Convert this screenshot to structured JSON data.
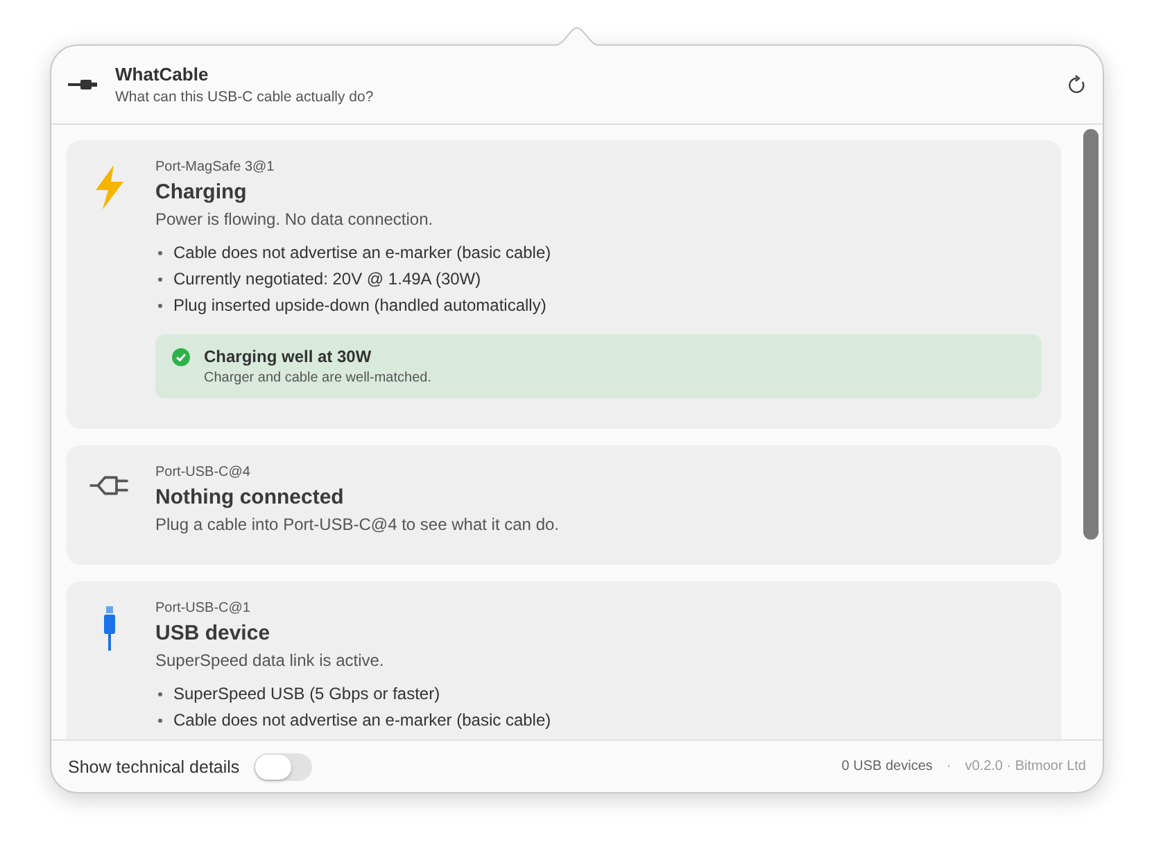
{
  "header": {
    "title": "WhatCable",
    "subtitle": "What can this USB-C cable actually do?"
  },
  "ports": [
    {
      "kind": "bolt",
      "port": "Port-MagSafe 3@1",
      "title": "Charging",
      "summary": "Power is flowing. No data connection.",
      "bullets": [
        "Cable does not advertise an e-marker (basic cable)",
        "Currently negotiated: 20V @ 1.49A (30W)",
        "Plug inserted upside-down (handled automatically)"
      ],
      "notice": {
        "title": "Charging well at 30W",
        "detail": "Charger and cable are well-matched."
      }
    },
    {
      "kind": "plug",
      "port": "Port-USB-C@4",
      "title": "Nothing connected",
      "summary": "Plug a cable into Port-USB-C@4 to see what it can do."
    },
    {
      "kind": "usb",
      "port": "Port-USB-C@1",
      "title": "USB device",
      "summary": "SuperSpeed data link is active.",
      "bullets": [
        "SuperSpeed USB (5 Gbps or faster)",
        "Cable does not advertise an e-marker (basic cable)"
      ]
    }
  ],
  "footer": {
    "toggle_label": "Show technical details",
    "on": false,
    "device_count": "0 USB devices",
    "separator": "·",
    "version": "v0.2.0 · Bitmoor Ltd"
  }
}
